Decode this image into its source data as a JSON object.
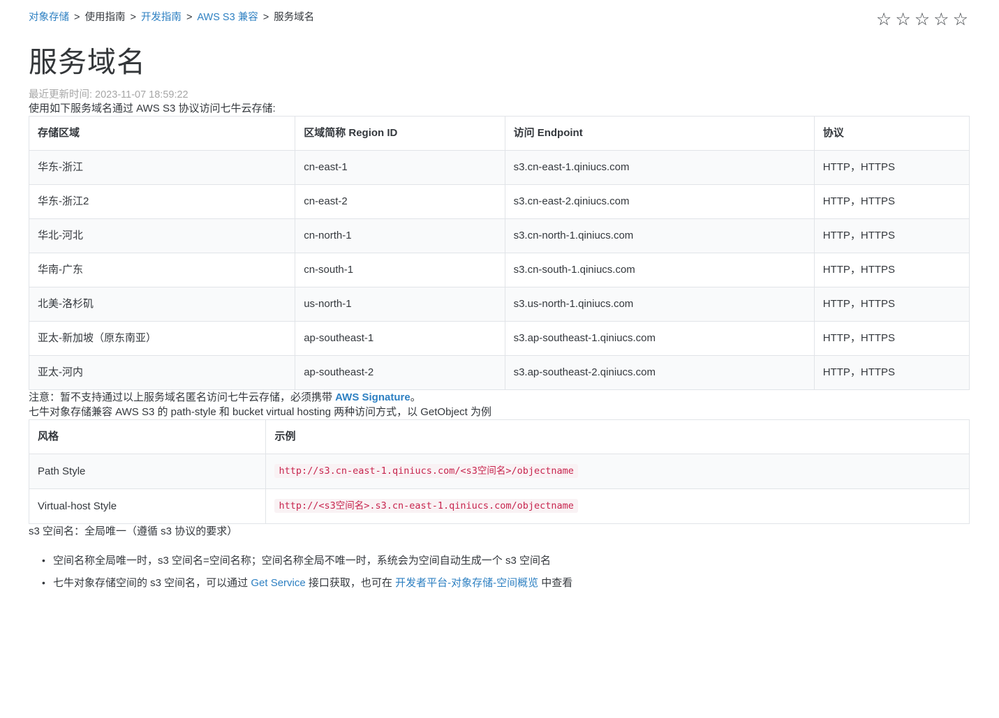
{
  "breadcrumb": {
    "separator": ">",
    "items": [
      {
        "label": "对象存储",
        "is_link": true
      },
      {
        "label": "使用指南",
        "is_link": false
      },
      {
        "label": "开发指南",
        "is_link": true
      },
      {
        "label": "AWS S3 兼容",
        "is_link": true
      },
      {
        "label": "服务域名",
        "is_link": false
      }
    ]
  },
  "rating": {
    "star_glyph": "☆",
    "star_count": 5
  },
  "page": {
    "title": "服务域名",
    "updated": "最近更新时间: 2023-11-07 18:59:22"
  },
  "intro": "使用如下服务域名通过 AWS S3 协议访问七牛云存储:",
  "regions_table": {
    "headers": [
      "存储区域",
      "区域简称 Region ID",
      "访问 Endpoint",
      "协议"
    ],
    "rows": [
      [
        "华东-浙江",
        "cn-east-1",
        "s3.cn-east-1.qiniucs.com",
        "HTTP，HTTPS"
      ],
      [
        "华东-浙江2",
        "cn-east-2",
        "s3.cn-east-2.qiniucs.com",
        "HTTP，HTTPS"
      ],
      [
        "华北-河北",
        "cn-north-1",
        "s3.cn-north-1.qiniucs.com",
        "HTTP，HTTPS"
      ],
      [
        "华南-广东",
        "cn-south-1",
        "s3.cn-south-1.qiniucs.com",
        "HTTP，HTTPS"
      ],
      [
        "北美-洛杉矶",
        "us-north-1",
        "s3.us-north-1.qiniucs.com",
        "HTTP，HTTPS"
      ],
      [
        "亚太-新加坡（原东南亚）",
        "ap-southeast-1",
        "s3.ap-southeast-1.qiniucs.com",
        "HTTP，HTTPS"
      ],
      [
        "亚太-河内",
        "ap-southeast-2",
        "s3.ap-southeast-2.qiniucs.com",
        "HTTP，HTTPS"
      ]
    ]
  },
  "note": {
    "prefix": "注意：暂不支持通过以上服务域名匿名访问七牛云存储，必须携带 ",
    "link_label": "AWS Signature",
    "suffix": "。"
  },
  "styles_intro": "七牛对象存储兼容 AWS S3 的 path-style 和 bucket virtual hosting 两种访问方式，以 GetObject 为例",
  "styles_table": {
    "headers": [
      "风格",
      "示例"
    ],
    "rows": [
      {
        "style": "Path Style",
        "example": "http://s3.cn-east-1.qiniucs.com/<s3空间名>/objectname"
      },
      {
        "style": "Virtual-host Style",
        "example": "http://<s3空间名>.s3.cn-east-1.qiniucs.com/objectname"
      }
    ]
  },
  "s3_note": "s3 空间名：全局唯一（遵循 s3 协议的要求）",
  "bullets": {
    "b1": "空间名称全局唯一时，s3 空间名=空间名称；空间名称全局不唯一时，系统会为空间自动生成一个 s3 空间名",
    "b2": {
      "part1": "七牛对象存储空间的 s3 空间名，可以通过 ",
      "link1": "Get Service",
      "part2": " 接口获取，也可在 ",
      "link2": "开发者平台-对象存储-空间概览",
      "part3": " 中查看"
    }
  },
  "colors": {
    "link_blue": "#2e80c2",
    "code_red": "#c7254e",
    "code_bg": "#f9f2f4",
    "stripe_gray": "#f9fafb",
    "border_gray": "#e1e4e8",
    "muted_gray": "#a6a6a6"
  }
}
